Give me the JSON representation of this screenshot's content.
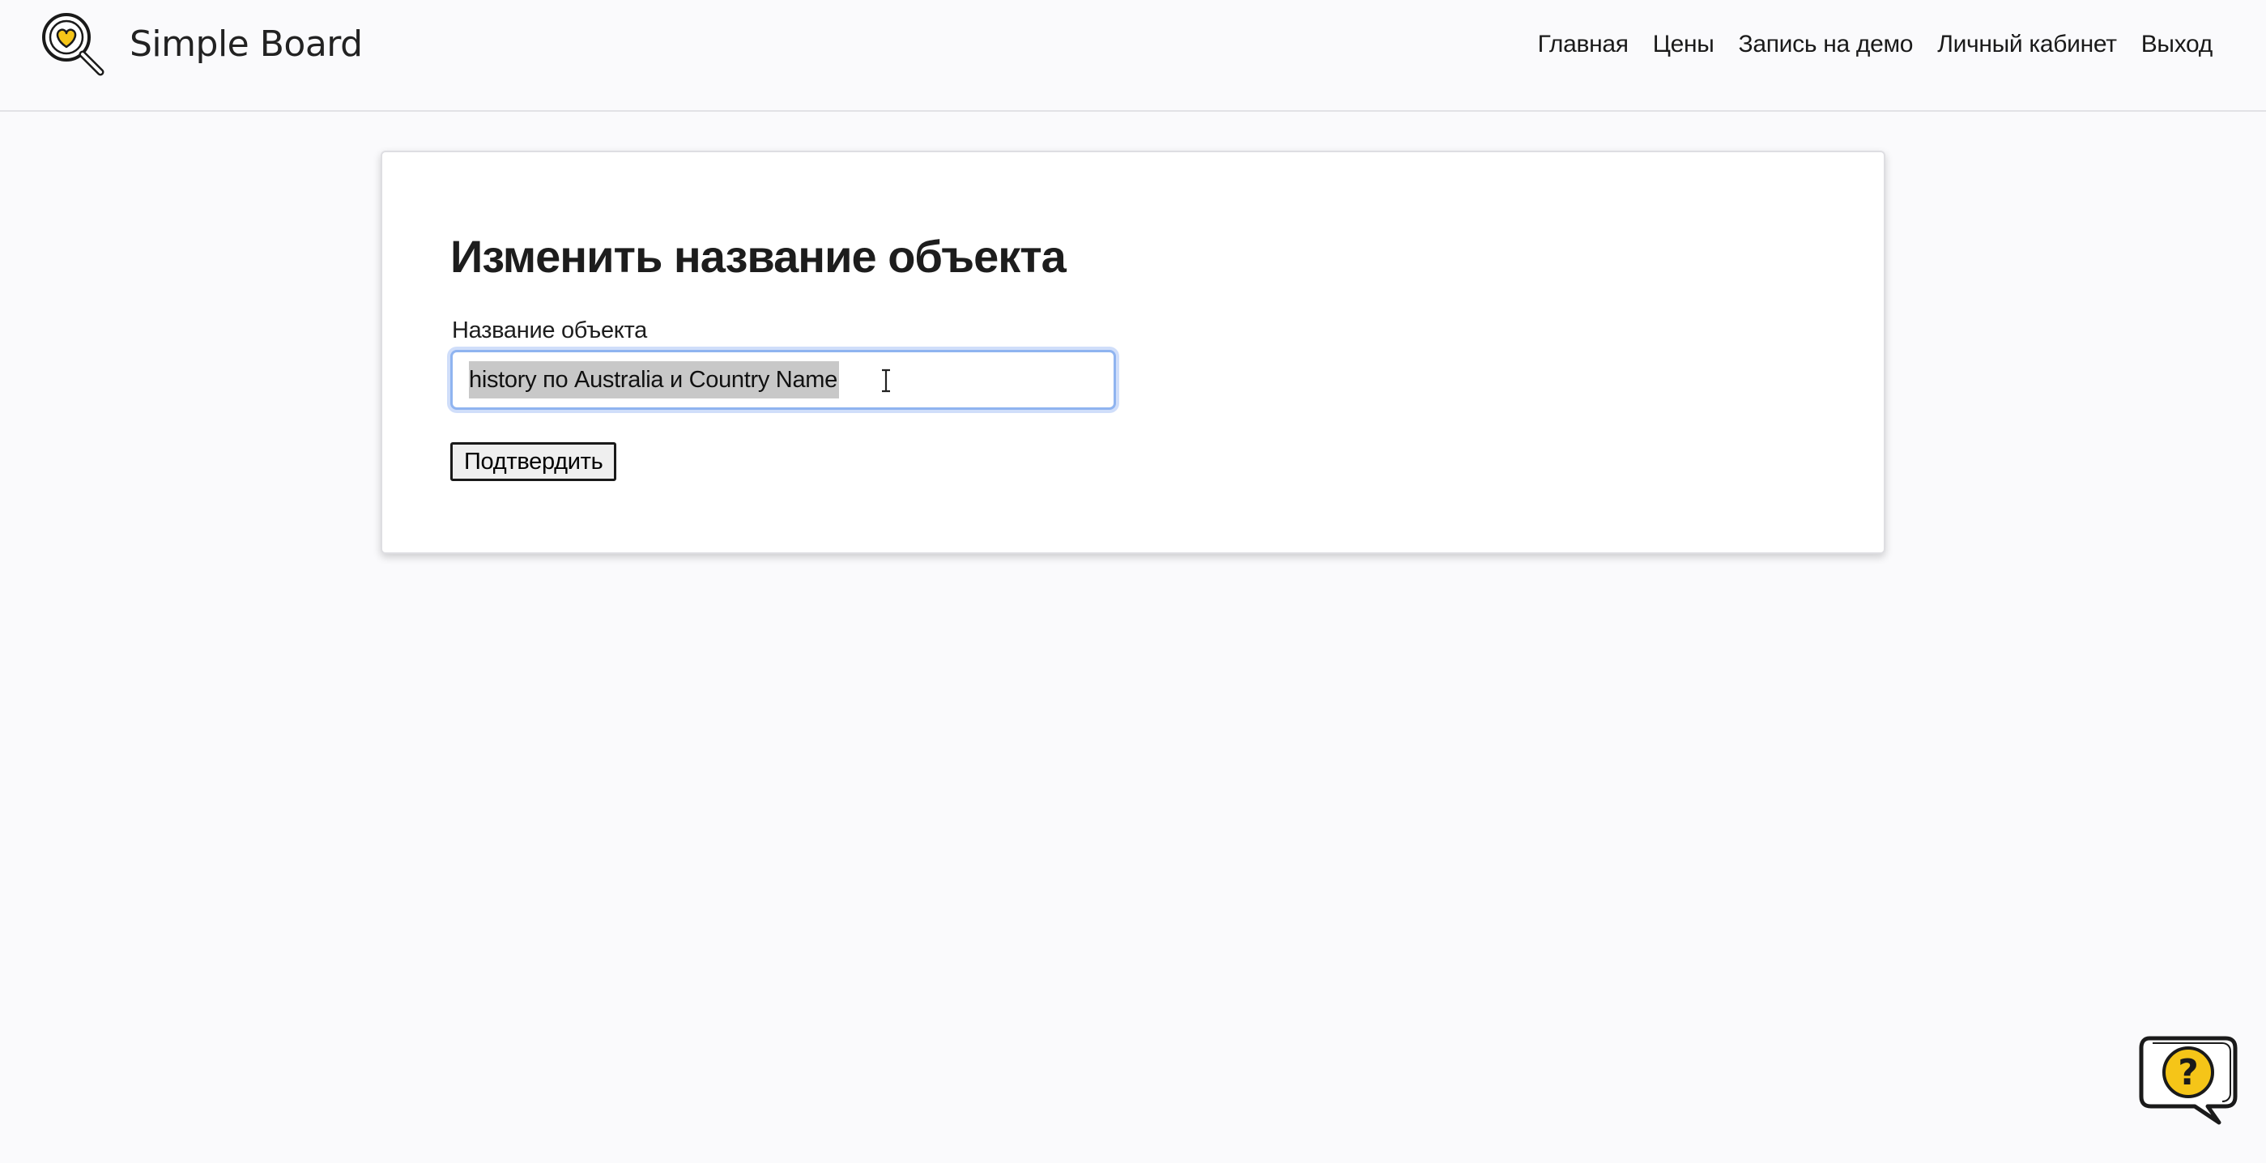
{
  "brand": {
    "name": "Simple Board",
    "logo_icon": "magnifier-heart-icon",
    "accent": "#f5c518"
  },
  "nav": {
    "items": [
      {
        "label": "Главная"
      },
      {
        "label": "Цены"
      },
      {
        "label": "Запись на демо"
      },
      {
        "label": "Личный кабинет"
      },
      {
        "label": "Выход"
      }
    ]
  },
  "form": {
    "title": "Изменить название объекта",
    "field_label": "Название объекта",
    "field_value": "history по Australia и Country Name",
    "submit_label": "Подтвердить"
  },
  "help": {
    "icon": "help-bubble-icon",
    "symbol": "?"
  }
}
